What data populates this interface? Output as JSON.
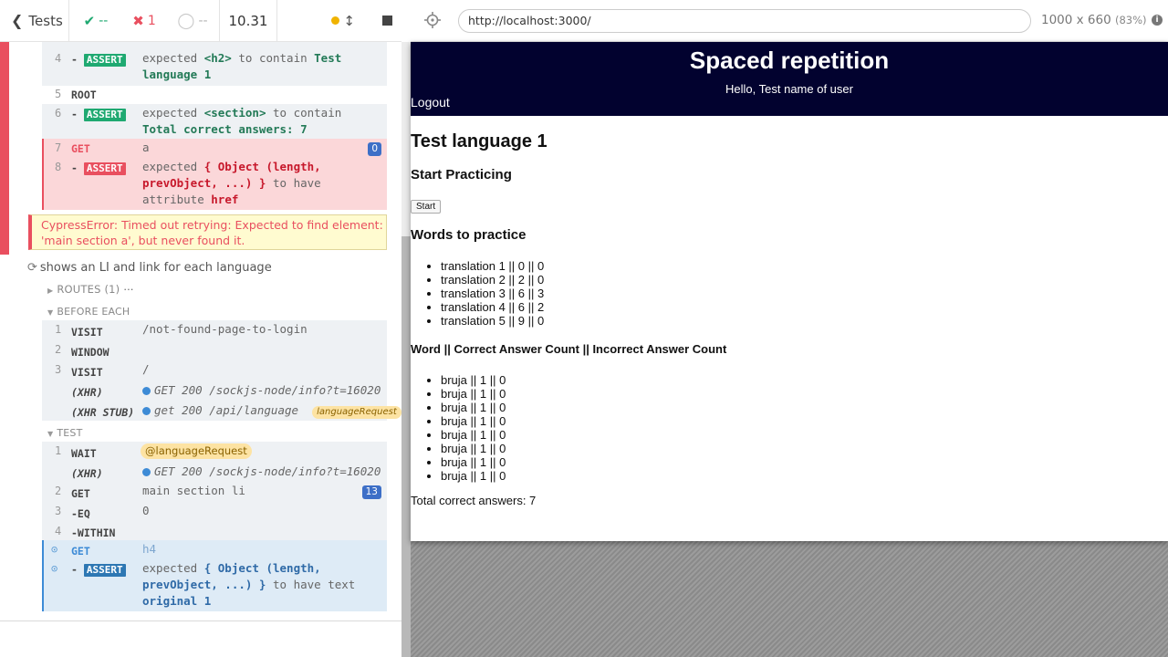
{
  "reporter": {
    "tests_label": "Tests",
    "stats": {
      "passed": "--",
      "failed": "1",
      "pending": "--"
    },
    "duration": "10.31"
  },
  "commands_top": [
    {
      "num": "4",
      "name": "-ASSERT",
      "status": "pass",
      "msg_prefix": "expected ",
      "msg_subject": "<h2>",
      "msg_mid": " to contain ",
      "msg_value": "Test language 1"
    },
    {
      "num": "5",
      "name": "ROOT"
    },
    {
      "num": "6",
      "name": "-ASSERT",
      "status": "pass",
      "msg_prefix": "expected ",
      "msg_subject": "<section>",
      "msg_mid": " to contain ",
      "msg_value": "Total correct answers: 7"
    },
    {
      "num": "7",
      "name": "GET",
      "status": "fail",
      "msg": "a",
      "count": "0"
    },
    {
      "num": "8",
      "name": "-ASSERT",
      "status": "fail",
      "msg_prefix": "expected ",
      "msg_subject": "{ Object (length, prevObject, ...) }",
      "msg_mid": " to have attribute ",
      "msg_value": "href"
    }
  ],
  "error": "CypressError: Timed out retrying: Expected to find element: 'main section a', but never found it.",
  "test2": {
    "title": "shows an LI and link for each language",
    "routes_label": "ROUTES (1)",
    "before_each_label": "BEFORE EACH",
    "test_label": "TEST",
    "before_each": [
      {
        "num": "1",
        "name": "VISIT",
        "msg": "/not-found-page-to-login"
      },
      {
        "num": "2",
        "name": "WINDOW",
        "msg": ""
      },
      {
        "num": "3",
        "name": "VISIT",
        "msg": "/"
      },
      {
        "num": "",
        "name": "(XHR)",
        "msg": "GET 200 /sockjs-node/info?t=16020..."
      },
      {
        "num": "",
        "name": "(XHR STUB)",
        "msg": "get 200 /api/language",
        "alias": "languageRequest"
      }
    ],
    "test": [
      {
        "num": "1",
        "name": "WAIT",
        "alias": "@languageRequest"
      },
      {
        "num": "",
        "name": "(XHR)",
        "msg": "GET 200 /sockjs-node/info?t=16020..."
      },
      {
        "num": "2",
        "name": "GET",
        "msg": "main section li",
        "count": "13"
      },
      {
        "num": "3",
        "name": "-EQ",
        "msg": "0"
      },
      {
        "num": "4",
        "name": "-WITHIN",
        "msg": ""
      },
      {
        "num": "",
        "name": "GET",
        "msg": "h4"
      },
      {
        "num": "",
        "name": "-ASSERT",
        "msg_prefix": "expected ",
        "msg_subject": "{ Object (length, prevObject, ...) }",
        "msg_mid": " to have text ",
        "msg_value": "original 1"
      }
    ]
  },
  "toolbar": {
    "url": "http://localhost:3000/",
    "viewport": "1000 x 660",
    "zoom": "(83%)"
  },
  "app": {
    "title": "Spaced repetition",
    "hello": "Hello, Test name of user",
    "logout": "Logout",
    "language": "Test language 1",
    "start_heading": "Start Practicing",
    "start_button": "Start",
    "words_heading": "Words to practice",
    "words": [
      "translation 1 || 0 || 0",
      "translation 2 || 2 || 0",
      "translation 3 || 6 || 3",
      "translation 4 || 6 || 2",
      "translation 5 || 9 || 0"
    ],
    "table_heading": "Word || Correct Answer Count || Incorrect Answer Count",
    "word_rows": [
      "bruja || 1 || 0",
      "bruja || 1 || 0",
      "bruja || 1 || 0",
      "bruja || 1 || 0",
      "bruja || 1 || 0",
      "bruja || 1 || 0",
      "bruja || 1 || 0",
      "bruja || 1 || 0"
    ],
    "total": "Total correct answers: 7"
  },
  "colors": {
    "pass": "#1fa971",
    "fail": "#e94f5f",
    "header_bg": "#02022f",
    "count_badge": "#3d6fc7"
  }
}
